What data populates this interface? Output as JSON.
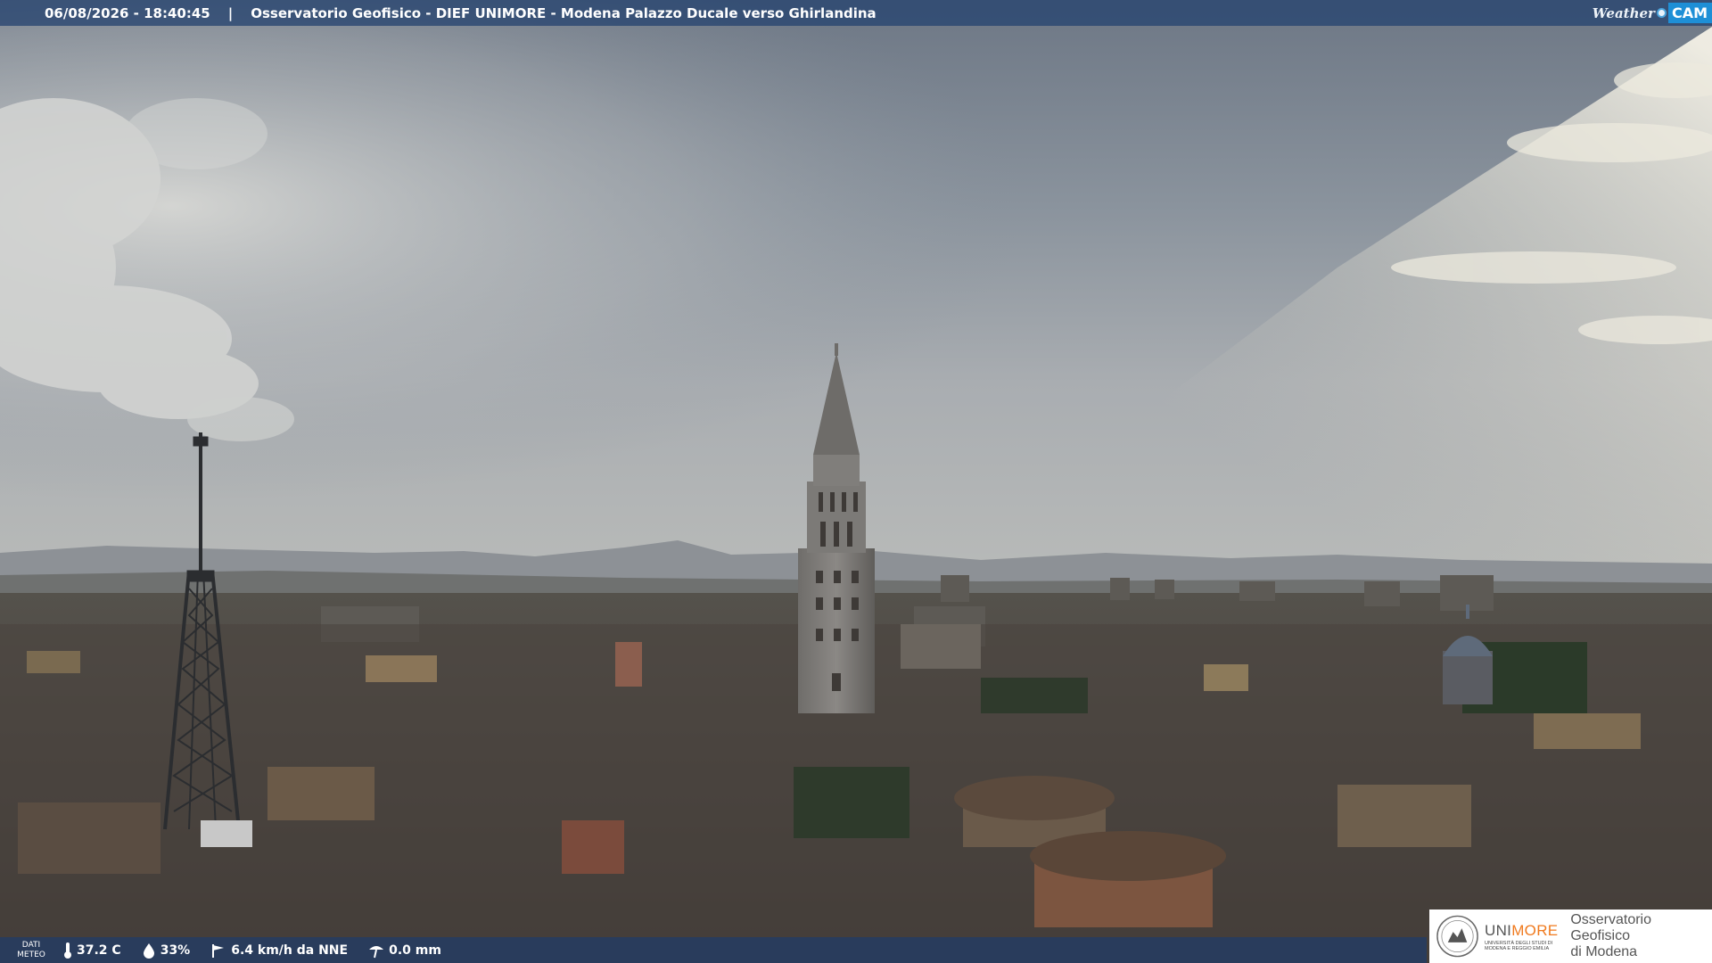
{
  "header": {
    "timestamp": "06/08/2026 - 18:40:45",
    "separator": "|",
    "title": "Osservatorio Geofisico - DIEF UNIMORE - Modena Palazzo Ducale verso Ghirlandina",
    "logo_weather": "Weather",
    "logo_cam": "CAM"
  },
  "weather": {
    "label_line1": "DATI",
    "label_line2": "METEO",
    "temperature": "37.2 C",
    "humidity": "33%",
    "wind": "6.4 km/h da NNE",
    "rain": "0.0 mm",
    "icons": [
      "thermometer-icon",
      "humidity-drop-icon",
      "wind-icon",
      "rain-gauge-icon"
    ]
  },
  "logo": {
    "brand_uni": "UNI",
    "brand_more": "MORE",
    "brand_sub_line1": "UNIVERSITÀ DEGLI STUDI DI",
    "brand_sub_line2": "MODENA E REGGIO EMILIA",
    "observatory_line1": "Osservatorio Geofisico",
    "observatory_line2": "di Modena"
  },
  "colors": {
    "bar": "#264470",
    "brand_orange": "#f07a1e",
    "cam_blue": "#1e8fd6"
  }
}
